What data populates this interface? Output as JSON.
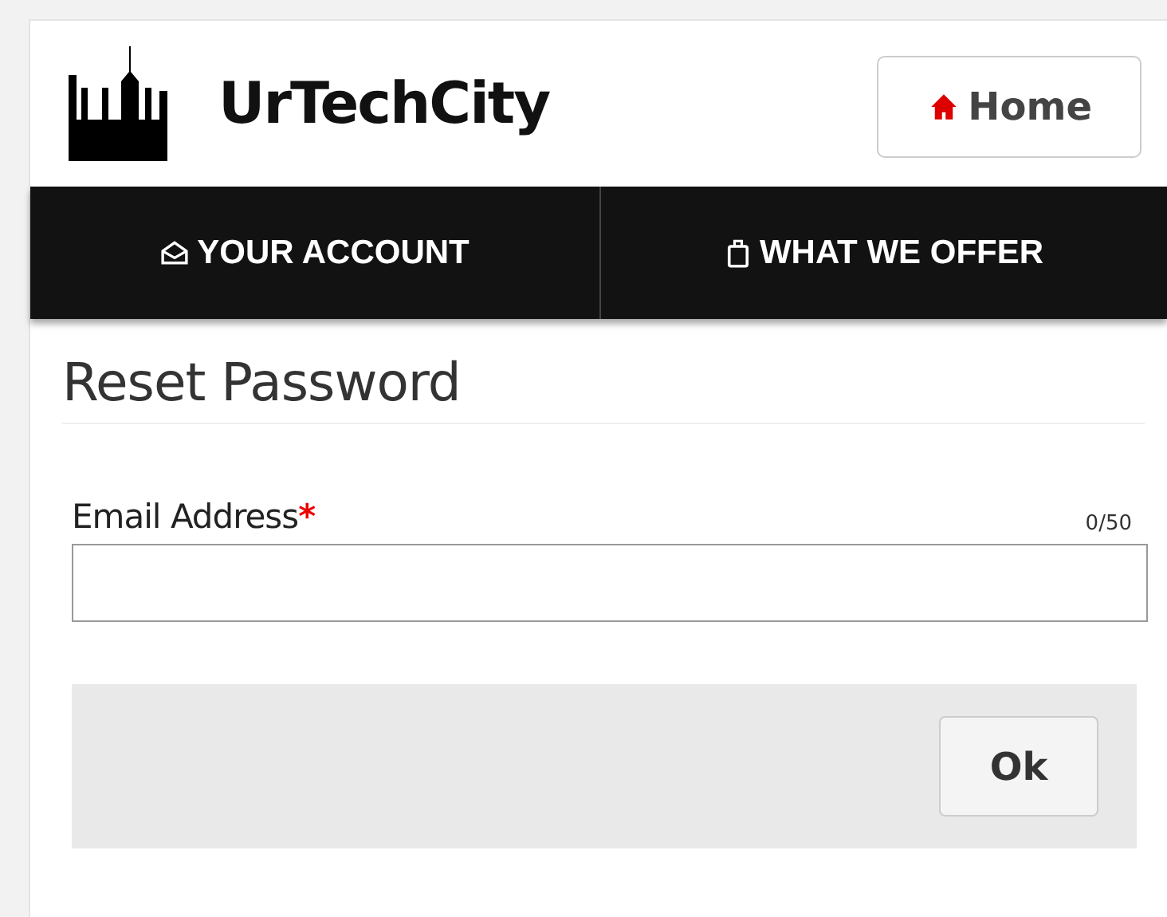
{
  "header": {
    "brand": "UrTechCity",
    "home_button": "Home"
  },
  "nav": [
    {
      "label": "YOUR ACCOUNT",
      "kind": "account"
    },
    {
      "label": "WHAT WE OFFER",
      "kind": "offer"
    }
  ],
  "form": {
    "title": "Reset Password",
    "field": {
      "label": "Email Address",
      "required_mark": "*",
      "counter": "0/50"
    },
    "button": "Ok"
  }
}
